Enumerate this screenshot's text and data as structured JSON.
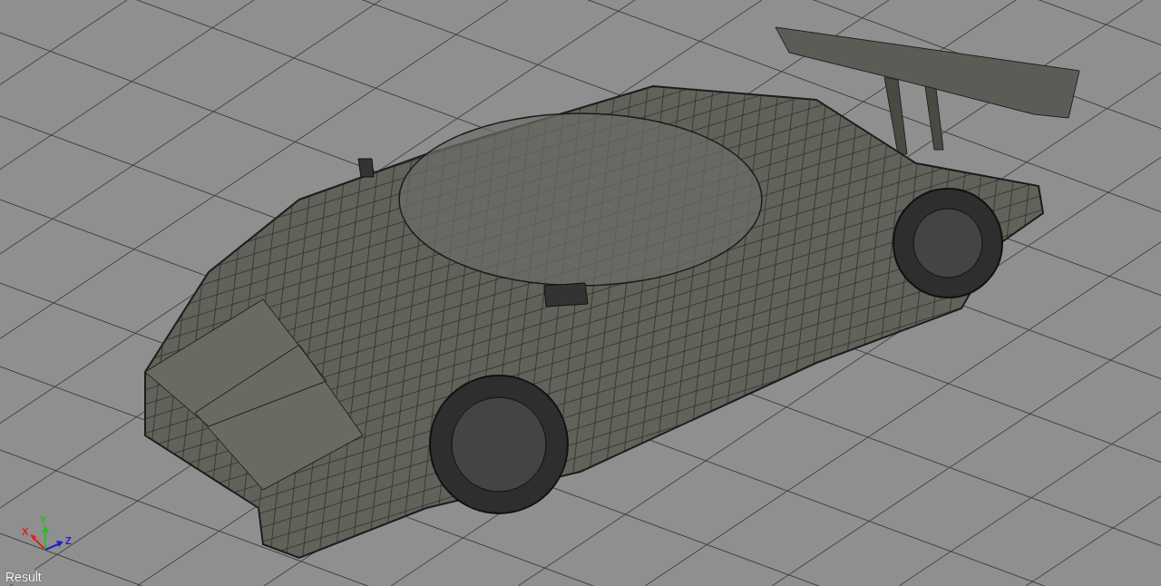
{
  "viewport": {
    "label": "Result",
    "axes": [
      {
        "label": "X",
        "color": "#e02020"
      },
      {
        "label": "Y",
        "color": "#22c022"
      },
      {
        "label": "Z",
        "color": "#2020d0"
      }
    ]
  }
}
